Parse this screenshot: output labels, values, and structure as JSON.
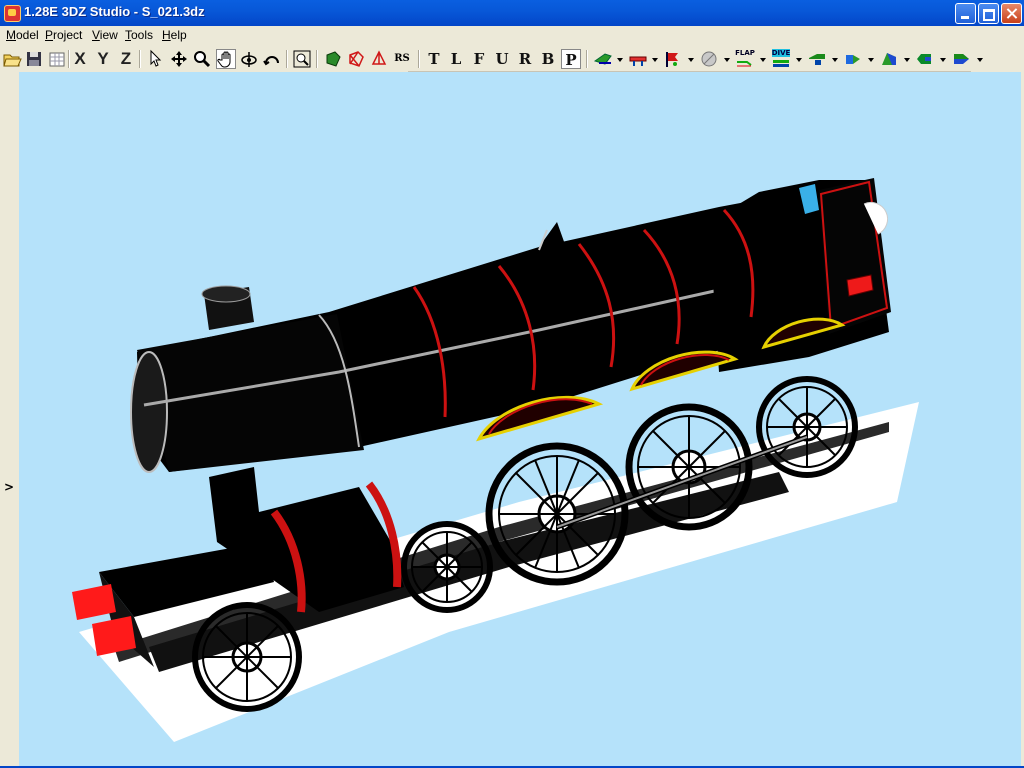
{
  "window": {
    "title": "1.28E 3DZ Studio - S_021.3dz",
    "app_icon": "app-icon",
    "buttons": [
      "minimize-icon",
      "maximize-icon",
      "close-icon"
    ]
  },
  "menu": [
    {
      "id": "model",
      "label": "Model"
    },
    {
      "id": "project",
      "label": "Project"
    },
    {
      "id": "view",
      "label": "View"
    },
    {
      "id": "tools",
      "label": "Tools"
    },
    {
      "id": "help",
      "label": "Help"
    }
  ],
  "toolbar": {
    "file_icons": [
      "open-folder-icon",
      "save-icon",
      "grid-icon"
    ],
    "axes": [
      "X",
      "Y",
      "Z"
    ],
    "tool_icons": [
      "select-arrow-icon",
      "move-icon",
      "zoom-icon",
      "pan-hand-icon",
      "rotate-icon",
      "orbit-icon"
    ],
    "render_icons": [
      "zoom-extents-icon",
      "solid-shade-icon",
      "wireframe-icon",
      "edges-icon"
    ],
    "rs_label": "RS",
    "views": [
      "T",
      "L",
      "F",
      "U",
      "R",
      "B",
      "P"
    ],
    "active_view": "P",
    "flap_label": "FLAP",
    "dive_label": "DIVE"
  },
  "colors": {
    "viewport_background": "#b5e2fa",
    "toolbar_background": "#ece9d8",
    "titlebar": "#0a5fe0",
    "locomotive_body": "#000000",
    "locomotive_lining": "#cc1111",
    "buffer": "#ff1a1a",
    "splasher_trim": "#e6d000"
  },
  "panel": {
    "toggle_icon": "chevron-right-icon"
  },
  "scene": {
    "model": "steam-locomotive-model"
  }
}
